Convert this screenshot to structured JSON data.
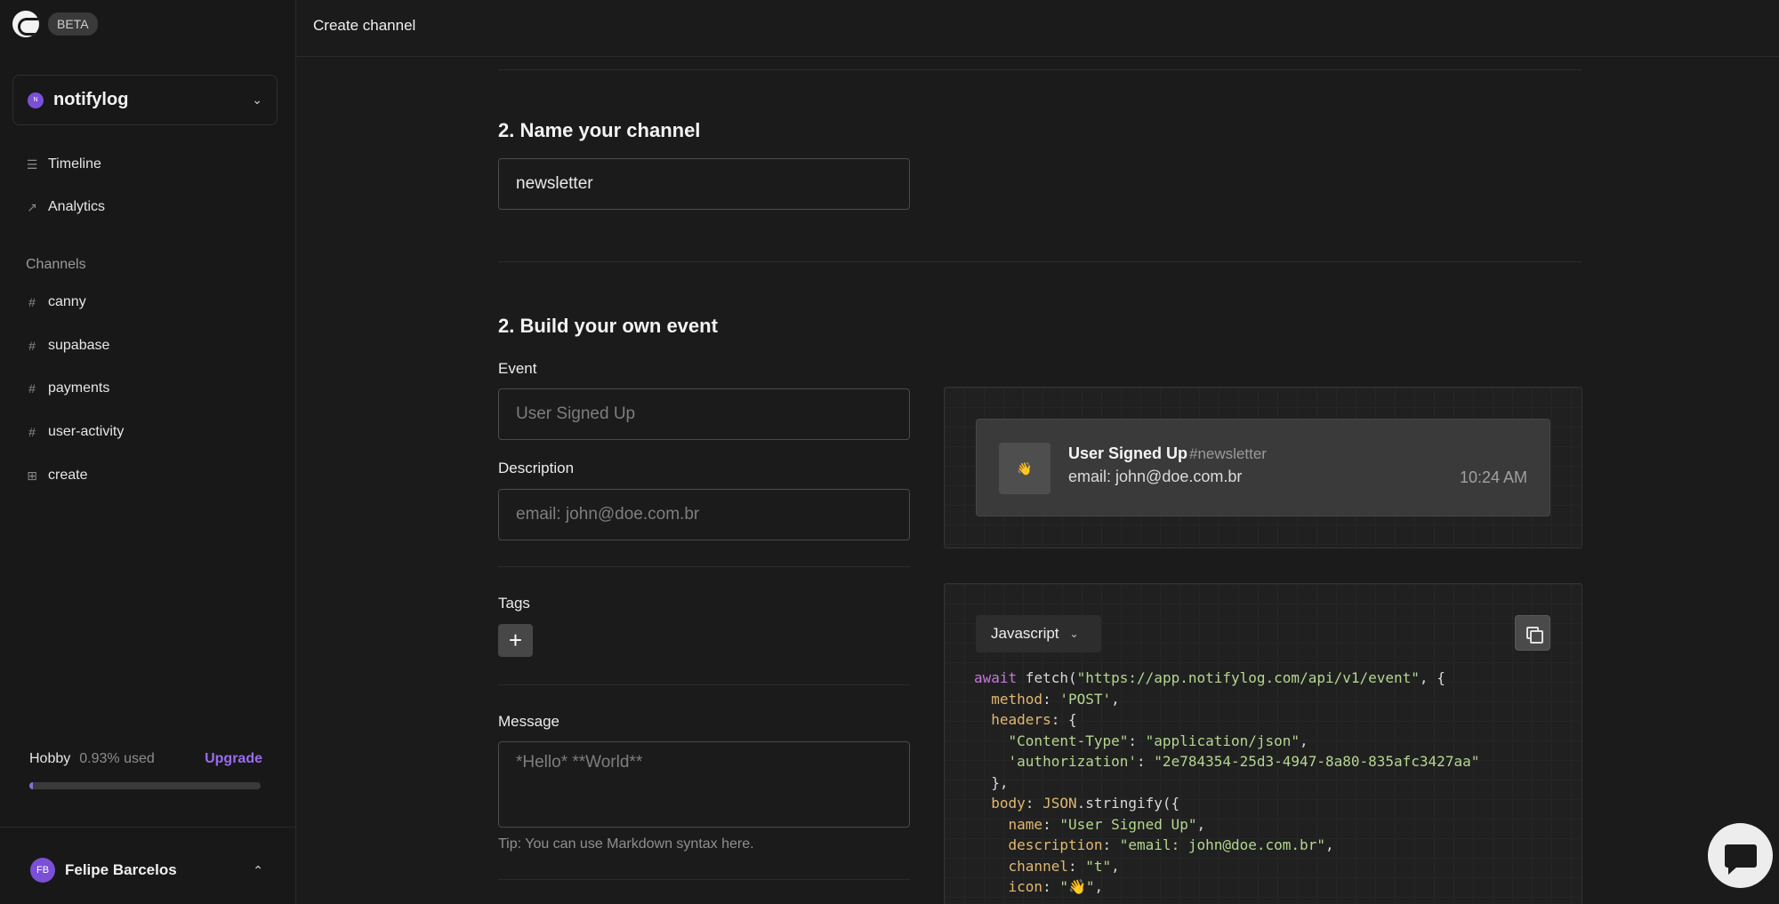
{
  "app": {
    "beta_label": "BETA",
    "page_title": "Create channel"
  },
  "workspace": {
    "initial": "N",
    "name": "notifylog"
  },
  "nav": {
    "timeline": "Timeline",
    "analytics": "Analytics",
    "channels_heading": "Channels",
    "channels": [
      "canny",
      "supabase",
      "payments",
      "user-activity"
    ],
    "create": "create"
  },
  "plan": {
    "name": "Hobby",
    "used": "0.93% used",
    "upgrade": "Upgrade",
    "usage_fraction": 0.0093
  },
  "user": {
    "initials": "FB",
    "name": "Felipe Barcelos"
  },
  "name_section": {
    "title": "2. Name your channel",
    "channel_value": "newsletter"
  },
  "event_section": {
    "title": "2. Build your own event",
    "event_label": "Event",
    "event_placeholder": "User Signed Up",
    "description_label": "Description",
    "description_placeholder": "email: john@doe.com.br",
    "tags_label": "Tags",
    "message_label": "Message",
    "message_placeholder": "*Hello* **World**",
    "tip": "Tip: You can use Markdown syntax here."
  },
  "preview": {
    "icon": "👋",
    "title": "User Signed Up",
    "channel": "#newsletter",
    "description": "email: john@doe.com.br",
    "time": "10:24 AM"
  },
  "code": {
    "language": "Javascript"
  },
  "colors": {
    "accent": "#9b6cf0",
    "avatar": "#7b4fd6",
    "background": "#1b1b1b"
  }
}
